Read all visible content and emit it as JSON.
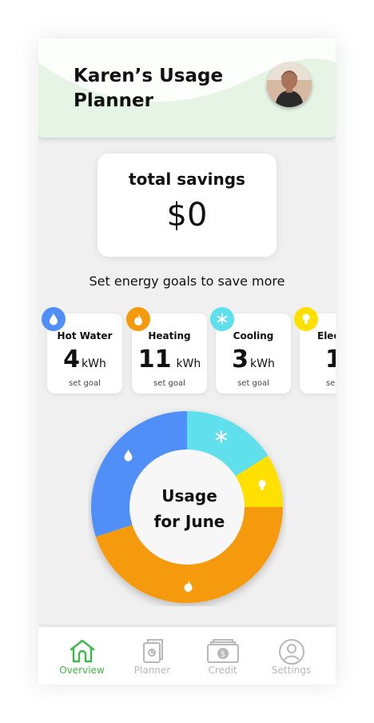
{
  "header": {
    "title_line1": "Karen’s Usage",
    "title_line2": "Planner",
    "background_color": "#e6f4e6"
  },
  "savings": {
    "label": "total savings",
    "value": "$0"
  },
  "goals": {
    "prompt": "Set energy goals to save more",
    "cards": [
      {
        "name": "Hot Water",
        "value": "4",
        "unit": "kWh",
        "action": "set goal",
        "icon": "water-drop-icon",
        "color": "#4f8ff7"
      },
      {
        "name": "Heating",
        "value": "11",
        "unit": "kWh",
        "action": "set goal",
        "icon": "flame-icon",
        "color": "#f59a0c"
      },
      {
        "name": "Cooling",
        "value": "3",
        "unit": "kWh",
        "action": "set goal",
        "icon": "snowflake-icon",
        "color": "#5ee0ec"
      },
      {
        "name": "Elec",
        "value": "1",
        "unit": "",
        "action": "se",
        "icon": "lightbulb-icon",
        "color": "#ffe000"
      }
    ]
  },
  "usage": {
    "label_line1": "Usage",
    "label_line2": "for June",
    "segments": [
      {
        "category": "Cooling",
        "share": 0.16,
        "color": "#5ee0ec",
        "icon": "snowflake-icon"
      },
      {
        "category": "Electricity",
        "share": 0.09,
        "color": "#ffe000",
        "icon": "lightbulb-icon"
      },
      {
        "category": "Heating",
        "share": 0.45,
        "color": "#f59a0c",
        "icon": "flame-icon"
      },
      {
        "category": "Hot Water",
        "share": 0.3,
        "color": "#4f8ff7",
        "icon": "water-drop-icon"
      }
    ]
  },
  "nav": {
    "items": [
      {
        "label": "Overview",
        "icon": "house-icon",
        "active": true
      },
      {
        "label": "Planner",
        "icon": "planner-icon",
        "active": false
      },
      {
        "label": "Credit",
        "icon": "credit-icon",
        "active": false
      },
      {
        "label": "Settings",
        "icon": "user-circle-icon",
        "active": false
      }
    ],
    "active_color": "#3db84a",
    "inactive_color": "#b8b8b8"
  }
}
